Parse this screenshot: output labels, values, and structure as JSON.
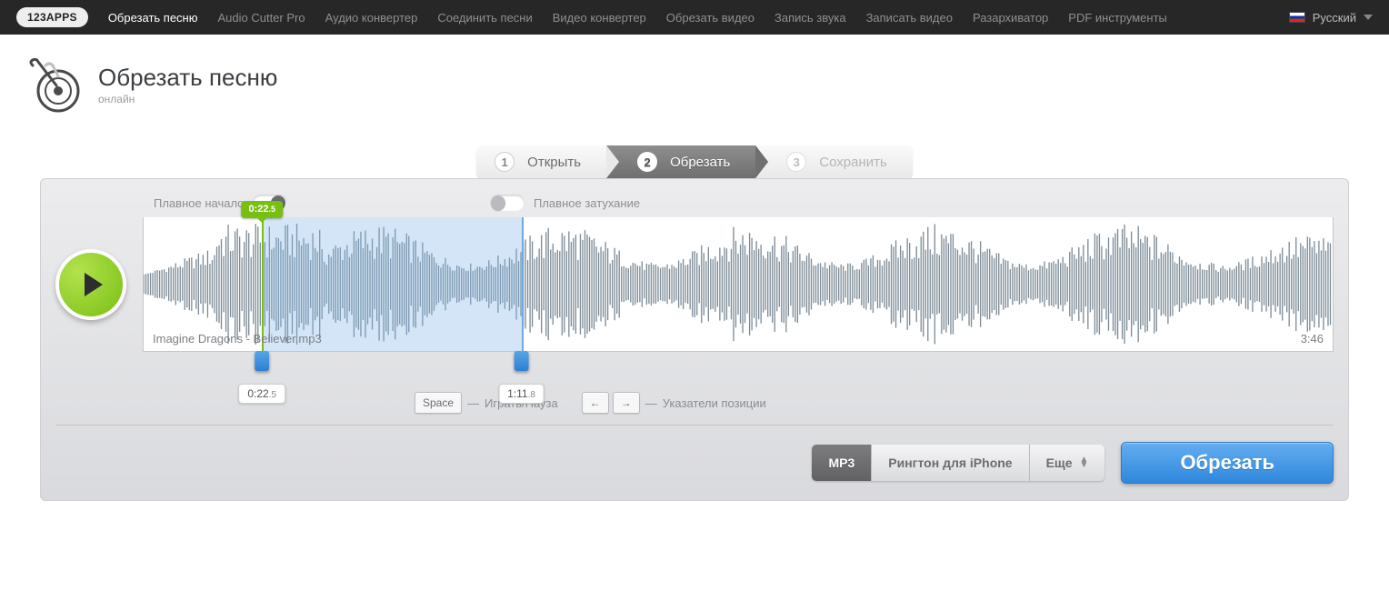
{
  "nav": {
    "brand": "123APPS",
    "items": [
      {
        "label": "Обрезать песню",
        "active": true
      },
      {
        "label": "Audio Cutter Pro",
        "active": false
      },
      {
        "label": "Аудио конвертер",
        "active": false
      },
      {
        "label": "Соединить песни",
        "active": false
      },
      {
        "label": "Видео конвертер",
        "active": false
      },
      {
        "label": "Обрезать видео",
        "active": false
      },
      {
        "label": "Запись звука",
        "active": false
      },
      {
        "label": "Записать видео",
        "active": false
      },
      {
        "label": "Разархиватор",
        "active": false
      },
      {
        "label": "PDF инструменты",
        "active": false
      }
    ],
    "language": "Русский"
  },
  "header": {
    "title": "Обрезать песню",
    "subtitle": "онлайн"
  },
  "steps": {
    "s1": {
      "num": "1",
      "label": "Открыть"
    },
    "s2": {
      "num": "2",
      "label": "Обрезать"
    },
    "s3": {
      "num": "3",
      "label": "Сохранить"
    }
  },
  "fade": {
    "in_label": "Плавное начало",
    "in_on": true,
    "out_label": "Плавное затухание",
    "out_on": false
  },
  "audio": {
    "filename": "Imagine Dragons - Believer.mp3",
    "duration_text": "3:46",
    "duration_sec": 226,
    "selection": {
      "start_sec": 22.5,
      "start_text": "0:22",
      "start_dec": ".5",
      "end_sec": 71.8,
      "end_text": "1:11",
      "end_dec": ".8"
    },
    "playhead": {
      "pos_sec": 22.5,
      "text": "0:22",
      "dec": ".5"
    }
  },
  "hints": {
    "space_key": "Space",
    "play_pause": "Играть/Пауза",
    "left_key": "←",
    "right_key": "→",
    "arrows_label": "Указатели позиции"
  },
  "formats": {
    "mp3": "MP3",
    "iphone": "Рингтон для iPhone",
    "more": "Еще"
  },
  "actions": {
    "cut": "Обрезать"
  }
}
